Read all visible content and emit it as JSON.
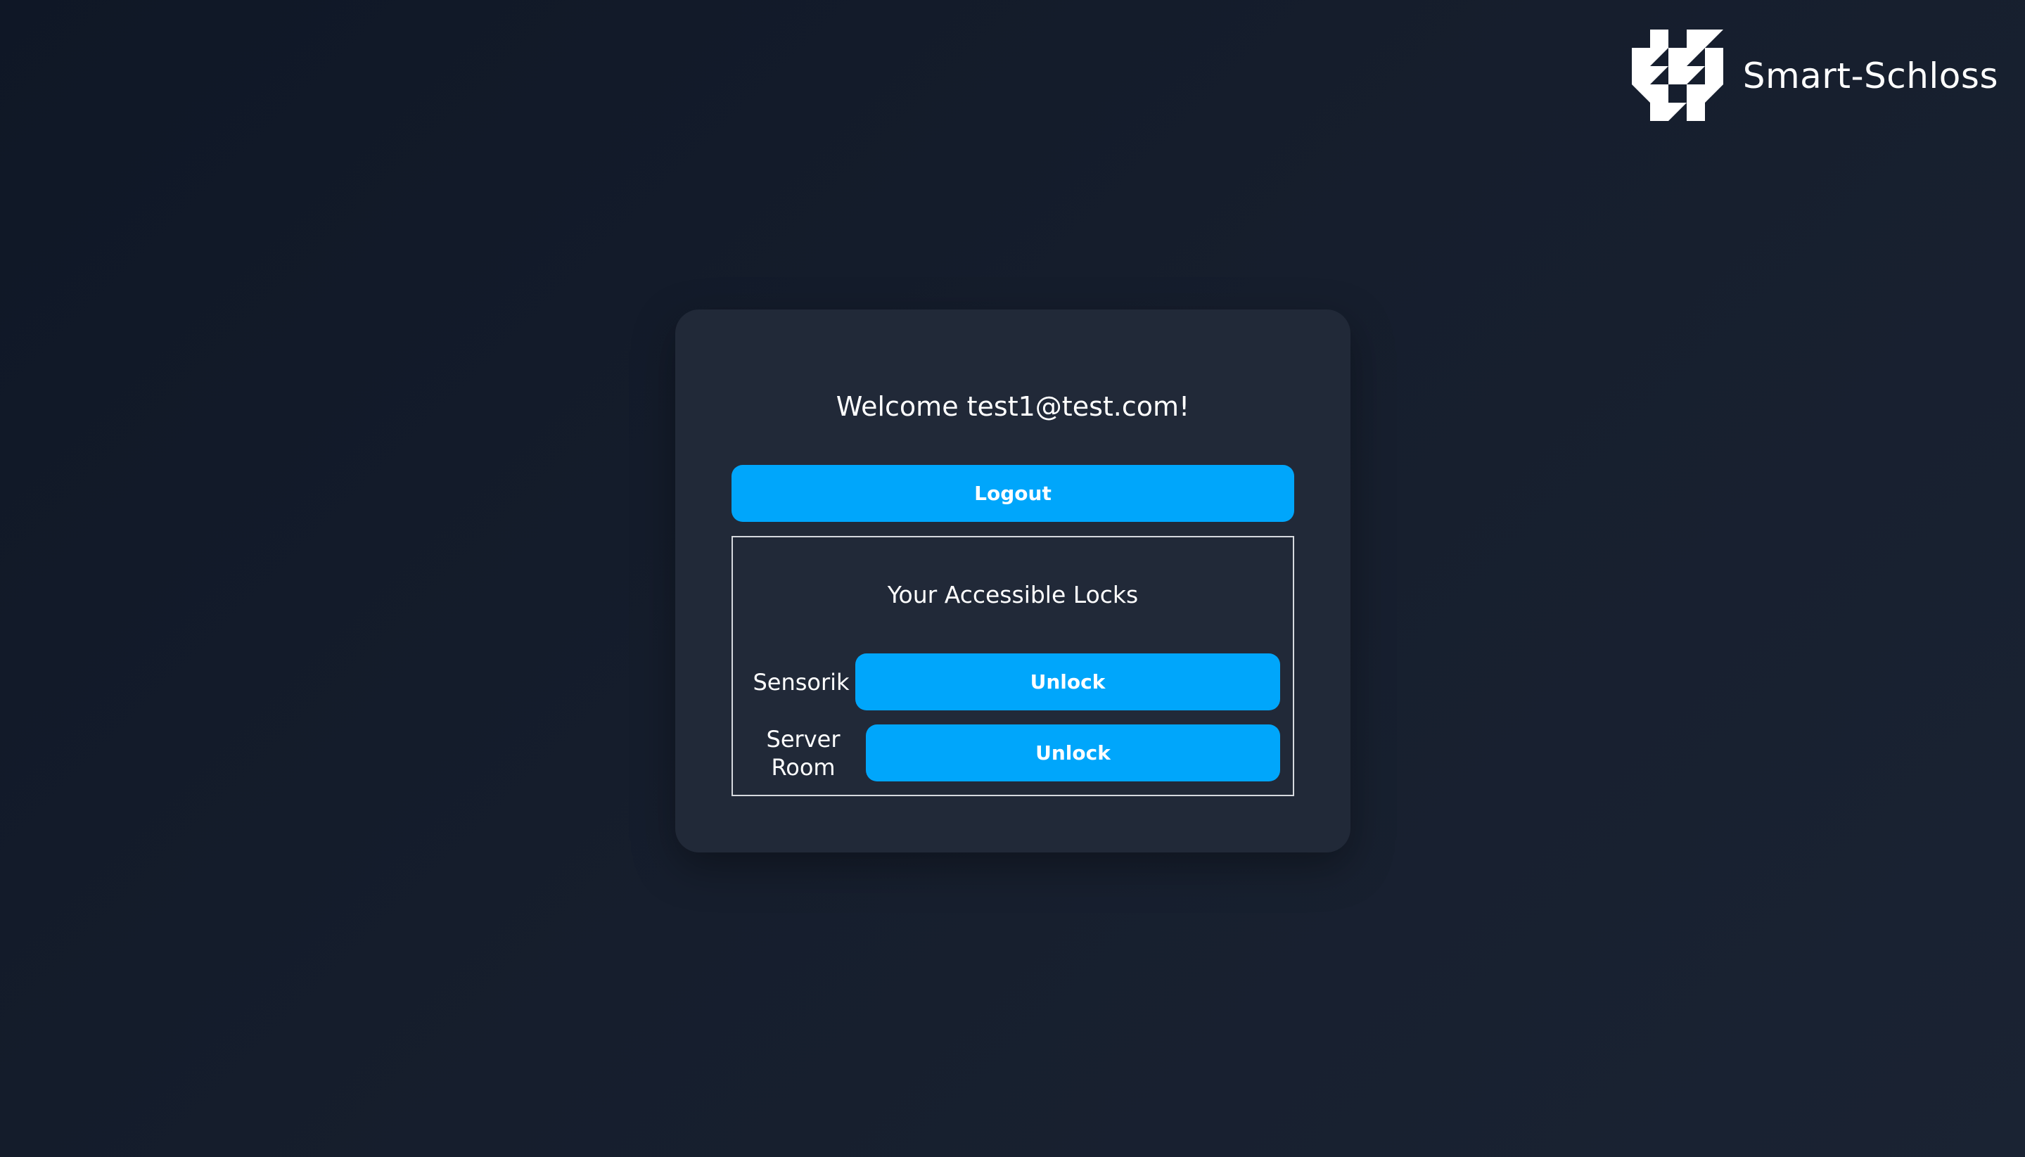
{
  "brand": {
    "name": "Smart-Schloss",
    "logo_icon": "checker-logo-icon"
  },
  "welcome": {
    "text": "Welcome test1@test.com!"
  },
  "actions": {
    "logout_label": "Logout"
  },
  "locks": {
    "title": "Your Accessible Locks",
    "items": [
      {
        "name": "Sensorik",
        "action_label": "Unlock"
      },
      {
        "name": "Server Room",
        "action_label": "Unlock"
      }
    ]
  },
  "colors": {
    "accent": "#00a6fb",
    "card": "#212938",
    "background": "#131b2a"
  }
}
